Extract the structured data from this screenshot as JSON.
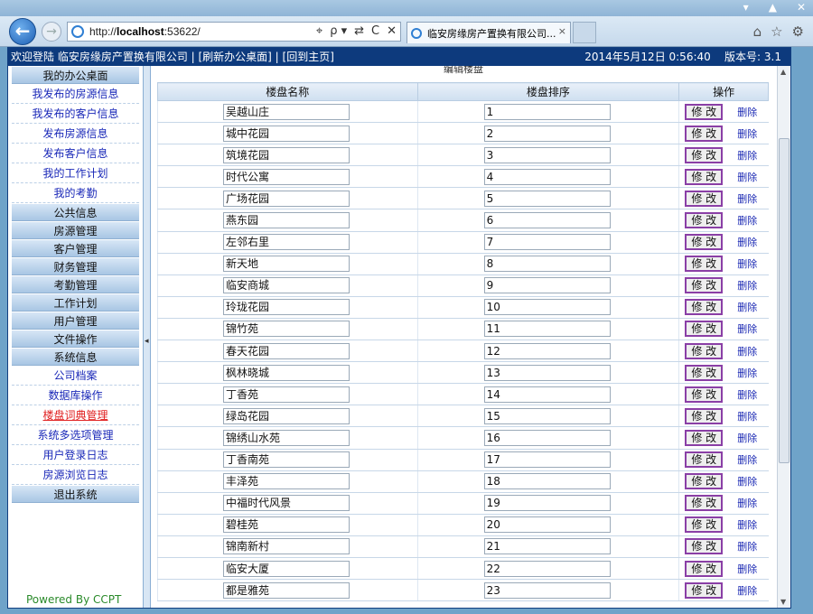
{
  "browser": {
    "url_prefix": "http://",
    "url_host": "localhost",
    "url_rest": ":53622/",
    "tab_title": "临安房缘房产置换有限公司...",
    "tab_close": "×",
    "window_buttons": [
      "▾",
      "▲",
      "✕"
    ],
    "addr_icons": [
      "⌖",
      "ρ ▾",
      "⇄",
      "C",
      "✕"
    ],
    "right_icons": [
      "⌂",
      "☆",
      "⚙"
    ]
  },
  "topbar": {
    "left": "欢迎登陆  临安房缘房产置换有限公司  | [刷新办公桌面] | [回到主页]",
    "datetime": "2014年5月12日  0:56:40",
    "version": "版本号: 3.1"
  },
  "sidebar": {
    "groups": [
      {
        "title": "我的办公桌面",
        "items": [
          "我发布的房源信息",
          "我发布的客户信息",
          "发布房源信息",
          "发布客户信息",
          "我的工作计划",
          "我的考勤"
        ]
      },
      {
        "title": "公共信息",
        "items": []
      },
      {
        "title": "房源管理",
        "items": []
      },
      {
        "title": "客户管理",
        "items": []
      },
      {
        "title": "财务管理",
        "items": []
      },
      {
        "title": "考勤管理",
        "items": []
      },
      {
        "title": "工作计划",
        "items": []
      },
      {
        "title": "用户管理",
        "items": []
      },
      {
        "title": "文件操作",
        "items": []
      },
      {
        "title": "系统信息",
        "items": [
          "公司档案",
          "数据库操作",
          "楼盘词典管理",
          "系统多选项管理",
          "用户登录日志",
          "房源浏览日志"
        ]
      },
      {
        "title": "退出系统",
        "items": []
      }
    ],
    "active_item": "楼盘词典管理",
    "powered": "Powered By CCPT"
  },
  "content": {
    "title": "编辑楼盘",
    "headers": [
      "楼盘名称",
      "楼盘排序",
      "操作"
    ],
    "edit_label": "修 改",
    "delete_label": "删除",
    "rows": [
      {
        "name": "吴越山庄",
        "order": "1"
      },
      {
        "name": "城中花园",
        "order": "2"
      },
      {
        "name": "筑境花园",
        "order": "3"
      },
      {
        "name": "时代公寓",
        "order": "4"
      },
      {
        "name": "广场花园",
        "order": "5"
      },
      {
        "name": "燕东园",
        "order": "6"
      },
      {
        "name": "左邻右里",
        "order": "7"
      },
      {
        "name": "新天地",
        "order": "8"
      },
      {
        "name": "临安商城",
        "order": "9"
      },
      {
        "name": "玲珑花园",
        "order": "10"
      },
      {
        "name": "锦竹苑",
        "order": "11"
      },
      {
        "name": "春天花园",
        "order": "12"
      },
      {
        "name": "枫林晓城",
        "order": "13"
      },
      {
        "name": "丁香苑",
        "order": "14"
      },
      {
        "name": "绿岛花园",
        "order": "15"
      },
      {
        "name": "锦绣山水苑",
        "order": "16"
      },
      {
        "name": "丁香南苑",
        "order": "17"
      },
      {
        "name": "丰泽苑",
        "order": "18"
      },
      {
        "name": "中福时代风景",
        "order": "19"
      },
      {
        "name": "碧桂苑",
        "order": "20"
      },
      {
        "name": "锦南新村",
        "order": "21"
      },
      {
        "name": "临安大厦",
        "order": "22"
      },
      {
        "name": "都是雅苑",
        "order": "23"
      }
    ]
  }
}
